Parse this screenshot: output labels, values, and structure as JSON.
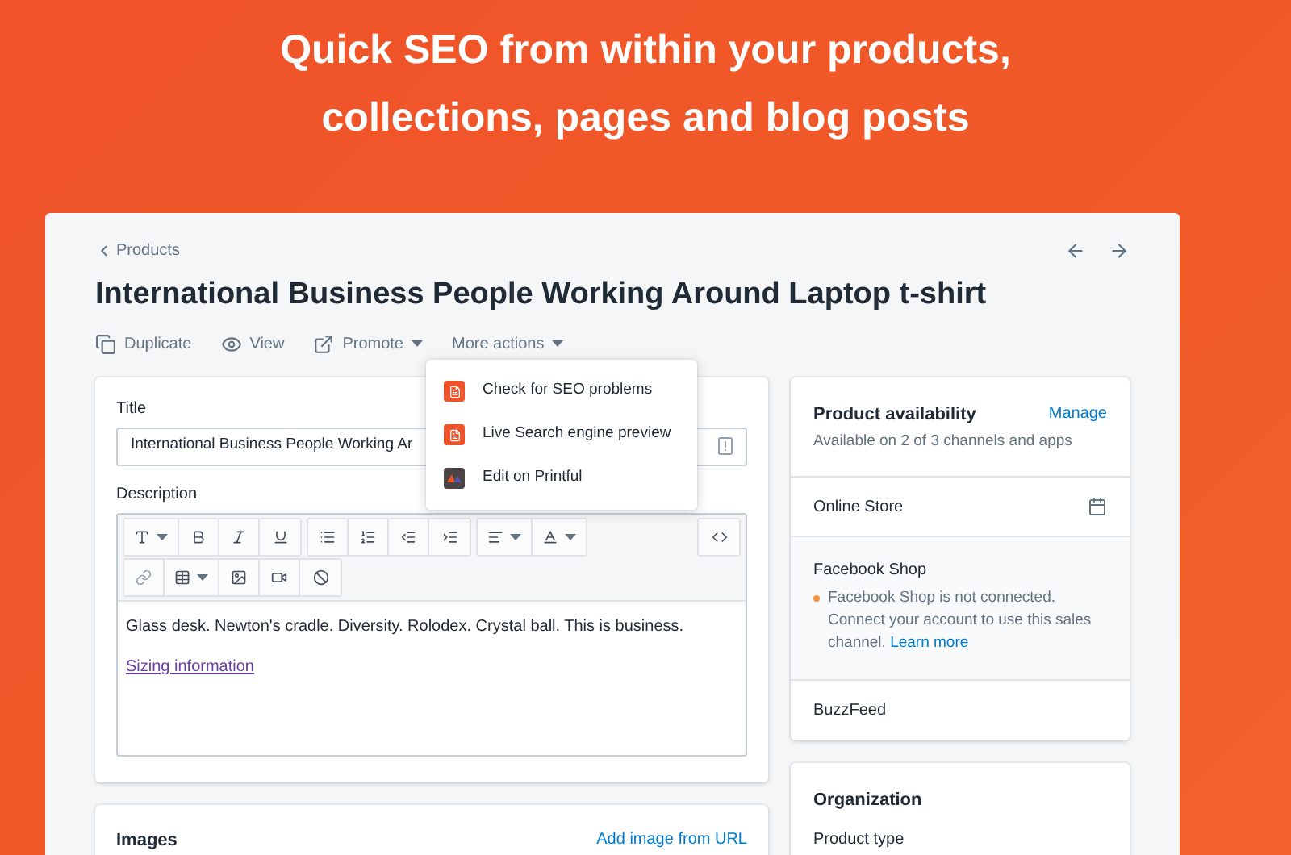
{
  "headline": [
    "Quick SEO from within your products,",
    "collections, pages and blog posts"
  ],
  "breadcrumb": "Products",
  "page_title": "International Business People Working Around Laptop t-shirt",
  "actions": [
    {
      "label": "Duplicate",
      "kind": "duplicate"
    },
    {
      "label": "View",
      "kind": "view"
    },
    {
      "label": "Promote",
      "kind": "promote"
    },
    {
      "label": "More actions",
      "kind": "more"
    }
  ],
  "dropdown": [
    {
      "label": "Check for SEO problems",
      "kind": "seo"
    },
    {
      "label": "Live Search engine preview",
      "kind": "seo"
    },
    {
      "label": "Edit on Printful",
      "kind": "printful"
    }
  ],
  "title_field": {
    "label": "Title",
    "value": "International Business People Working Ar"
  },
  "description": {
    "label": "Description",
    "text": "Glass desk. Newton's cradle. Diversity. Rolodex. Crystal ball. This is business.",
    "link": "Sizing information"
  },
  "images_card": {
    "title": "Images",
    "link": "Add image from URL"
  },
  "availability": {
    "title": "Product availability",
    "action": "Manage",
    "subtitle": "Available on 2 of 3 channels and apps",
    "channels": [
      {
        "name": "Online Store",
        "kind": "calendar"
      },
      {
        "name": "Facebook Shop",
        "kind": "notice",
        "notice": "Facebook Shop is not connected. Connect your account to use this sales channel.",
        "link": "Learn more",
        "color": "#f49342"
      },
      {
        "name": "BuzzFeed",
        "kind": "plain"
      }
    ]
  },
  "organization": {
    "title": "Organization",
    "field_label": "Product type"
  }
}
